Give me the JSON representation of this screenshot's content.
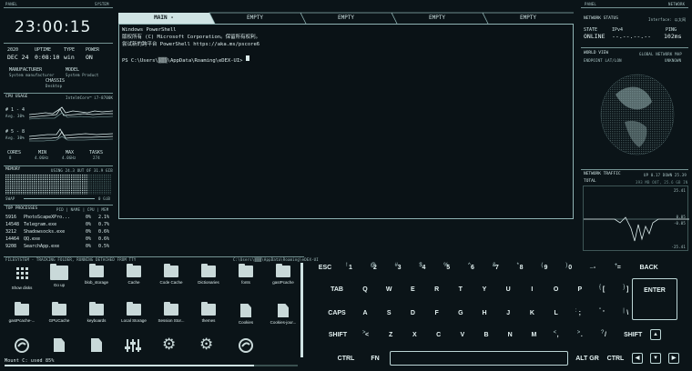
{
  "left": {
    "panel_label": "PANEL",
    "system_label": "SYSTEM",
    "clock": "23:00:15",
    "date": {
      "year": "2020",
      "day": "DEC 24"
    },
    "uptime": {
      "label": "UPTIME",
      "value": "0:08:10"
    },
    "type": {
      "label": "TYPE",
      "value": "win"
    },
    "power": {
      "label": "POWER",
      "value": "ON"
    },
    "manufacturer": {
      "label": "MANUFACTURER",
      "value": "System manufacturer"
    },
    "model": {
      "label": "MODEL",
      "value": "System Product"
    },
    "chassis": {
      "label": "CHASSIS",
      "value": "Desktop"
    },
    "cpu": {
      "label": "CPU USAGE",
      "model": "Intel®Core™ i7-8700K",
      "core_a": "# 1 - 4",
      "avg_a": "Avg. 30%",
      "core_b": "# 5 - 8",
      "avg_b": "Avg. 30%"
    },
    "stats": [
      {
        "label": "CORES",
        "value": "8"
      },
      {
        "label": "MIN",
        "value": "4.0GHz"
      },
      {
        "label": "MAX",
        "value": "4.0GHz"
      },
      {
        "label": "TASKS",
        "value": "274"
      }
    ],
    "memory": {
      "label": "MEMORY",
      "usage": "USING 24.3 OUT OF 31.9 GIB",
      "swap": "SWAP",
      "swap_val": "0 GiB"
    },
    "top": {
      "label": "TOP PROCESSES",
      "cols": "PID | NAME | CPU | MEM",
      "rows": [
        {
          "pid": "5916",
          "name": "PhotoScapeXPro...",
          "cpu": "0%",
          "mem": "2.1%"
        },
        {
          "pid": "14548",
          "name": "Telegram.exe",
          "cpu": "0%",
          "mem": "0.7%"
        },
        {
          "pid": "3212",
          "name": "Shadowsocks.exe",
          "cpu": "0%",
          "mem": "0.6%"
        },
        {
          "pid": "14464",
          "name": "QQ.exe",
          "cpu": "0%",
          "mem": "0.6%"
        },
        {
          "pid": "9208",
          "name": "SearchApp.exe",
          "cpu": "0%",
          "mem": "0.5%"
        }
      ]
    }
  },
  "terminal": {
    "tabs": [
      "MAIN -",
      "EMPTY",
      "EMPTY",
      "EMPTY",
      "EMPTY",
      "EMPTY"
    ],
    "lines": [
      "Windows PowerShell",
      "版权所有 (C) Microsoft Corporation。保留所有权利。",
      "",
      "尝试新的跨平台 PowerShell https://aka.ms/pscore6",
      "",
      "PS C:\\Users\\▒▒▒\\AppData\\Roaming\\eDEX-UI> "
    ]
  },
  "files": {
    "header": "FILESYSTEM - TRACKING FOLDER, RUNNING DETACHED FROM TTY",
    "path": "C:\\Users\\▒▒▒\\AppData\\Roaming\\eDEX-UI",
    "items": [
      "Show disks",
      "Go up",
      "blob_storage",
      "Cache",
      "Code Cache",
      "Dictionaries",
      "fonts",
      "gasIPcache",
      "gasIPcache-...",
      "GPUCache",
      "keyboards",
      "Local Storage",
      "Session Stor...",
      "themes",
      "Cookies",
      "Cookies-jour...",
      "",
      "",
      "",
      "",
      "",
      "",
      "",
      ""
    ],
    "mount": "Mount C: used 85%"
  },
  "keyboard": {
    "row1": [
      {
        "k": "ESC"
      },
      {
        "k": "1",
        "s": "!"
      },
      {
        "k": "2",
        "s": "@"
      },
      {
        "k": "3",
        "s": "#"
      },
      {
        "k": "4",
        "s": "$"
      },
      {
        "k": "5",
        "s": "%"
      },
      {
        "k": "6",
        "s": "^"
      },
      {
        "k": "7",
        "s": "&"
      },
      {
        "k": "8",
        "s": "*"
      },
      {
        "k": "9",
        "s": "("
      },
      {
        "k": "0",
        "s": ")"
      },
      {
        "k": "-",
        "s": "_"
      },
      {
        "k": "=",
        "s": "+"
      },
      {
        "k": "BACK"
      }
    ],
    "row2": [
      {
        "k": "TAB"
      },
      {
        "k": "Q"
      },
      {
        "k": "W"
      },
      {
        "k": "E"
      },
      {
        "k": "R"
      },
      {
        "k": "T"
      },
      {
        "k": "Y"
      },
      {
        "k": "U"
      },
      {
        "k": "I"
      },
      {
        "k": "O"
      },
      {
        "k": "P"
      },
      {
        "k": "[",
        "s": "{"
      },
      {
        "k": "]",
        "s": "}"
      }
    ],
    "enter": "ENTER",
    "row3": [
      {
        "k": "CAPS"
      },
      {
        "k": "A"
      },
      {
        "k": "S"
      },
      {
        "k": "D"
      },
      {
        "k": "F"
      },
      {
        "k": "G"
      },
      {
        "k": "H"
      },
      {
        "k": "J"
      },
      {
        "k": "K"
      },
      {
        "k": "L"
      },
      {
        "k": ";",
        "s": ":"
      },
      {
        "k": "'",
        "s": "\""
      },
      {
        "k": "\\",
        "s": "|"
      }
    ],
    "row4": [
      {
        "k": "SHIFT"
      },
      {
        "k": "<",
        "s": ">"
      },
      {
        "k": "Z"
      },
      {
        "k": "X"
      },
      {
        "k": "C"
      },
      {
        "k": "V"
      },
      {
        "k": "B"
      },
      {
        "k": "N"
      },
      {
        "k": "M"
      },
      {
        "k": ",",
        "s": "<"
      },
      {
        "k": ".",
        "s": ">"
      },
      {
        "k": "/",
        "s": "?"
      },
      {
        "k": "SHIFT"
      }
    ],
    "ctrl": "CTRL",
    "fn": "FN",
    "altgr": "ALT GR",
    "ctrl2": "CTRL"
  },
  "right": {
    "panel_label": "PANEL",
    "network_label": "NETWORK",
    "status": {
      "label": "NETWORK STATUS",
      "iface": "Interface: 以太网",
      "state_label": "STATE",
      "state": "ONLINE",
      "ipv4_label": "IPv4",
      "ipv4": "--.--.--.--",
      "ping_label": "PING",
      "ping": "102ms"
    },
    "world": {
      "label": "WORLD VIEW",
      "map": "GLOBAL NETWORK MAP",
      "endpoint": "ENDPOINT LAT/LON",
      "unknown": "UNKNOWN"
    },
    "traffic": {
      "label": "NETWORK TRAFFIC",
      "updown": "UP 0.17 DOWN 25.39",
      "total": "TOTAL",
      "totalval": "393 MB OUT, 25.6 GB IN",
      "v1": "25.41",
      "v2": "0.05",
      "v3": "-0.05",
      "v4": "-25.41"
    }
  }
}
